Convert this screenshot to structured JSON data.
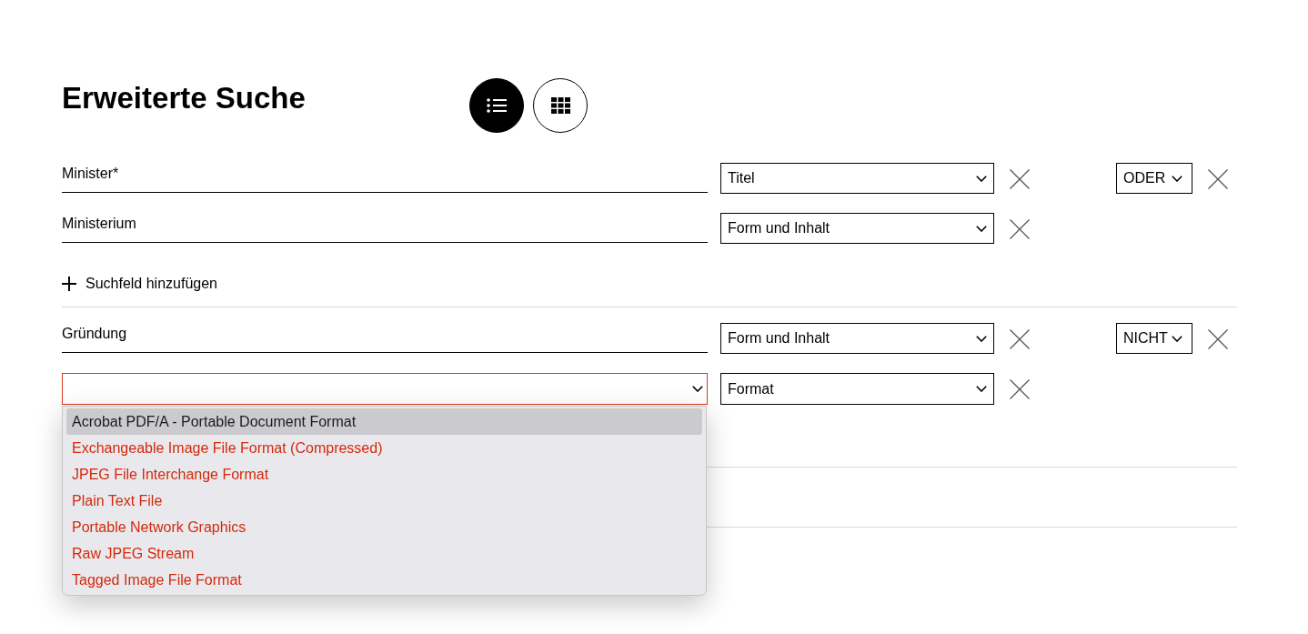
{
  "page": {
    "title": "Erweiterte Suche"
  },
  "view_toggle": [
    {
      "kind": "list",
      "selected": true
    },
    {
      "kind": "grid",
      "selected": false
    }
  ],
  "groups": [
    {
      "rows": [
        {
          "kind": "text",
          "value": "Minister*",
          "field": "Titel",
          "operator": "ODER"
        },
        {
          "kind": "text",
          "value": "Ministerium",
          "field": "Form und Inhalt"
        }
      ],
      "add_field": "Suchfeld hinzufügen"
    },
    {
      "rows": [
        {
          "kind": "text",
          "value": "Gründung",
          "field": "Form und Inhalt",
          "operator": "NICHT"
        },
        {
          "kind": "select",
          "invalid": true,
          "expanded": true,
          "field": "Format",
          "options": [
            {
              "label": "Acrobat PDF/A - Portable Document Format",
              "selected": true
            },
            {
              "label": "Exchangeable Image File Format (Compressed)",
              "selected": false
            },
            {
              "label": "JPEG File Interchange Format",
              "selected": false
            },
            {
              "label": "Plain Text File",
              "selected": false
            },
            {
              "label": "Portable Network Graphics",
              "selected": false
            },
            {
              "label": "Raw JPEG Stream",
              "selected": false
            },
            {
              "label": "Tagged Image File Format",
              "selected": false
            }
          ]
        }
      ]
    }
  ]
}
